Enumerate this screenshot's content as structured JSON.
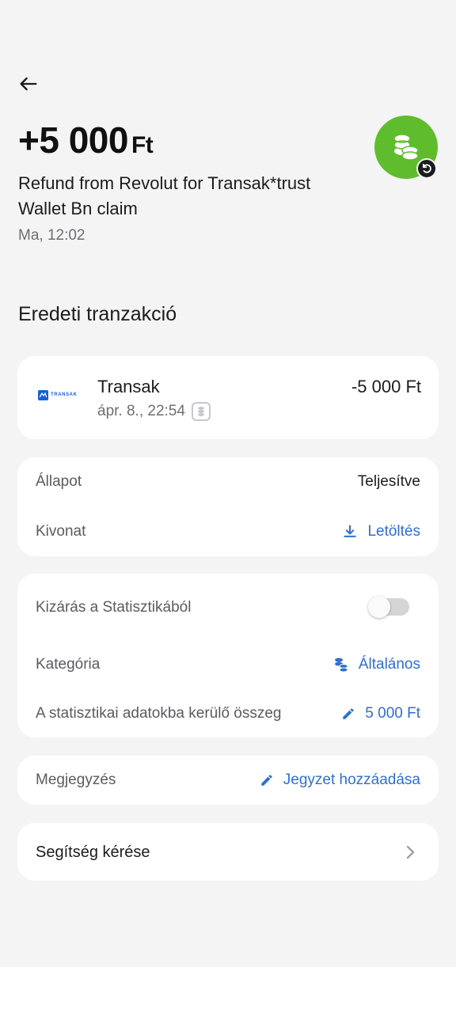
{
  "header": {
    "amount": "+5 000",
    "currency": "Ft",
    "description": "Refund from Revolut for Transak*trust Wallet Bn claim",
    "time": "Ma, 12:02",
    "avatar_color": "#5fbd2d",
    "avatar_icon": "coins-icon",
    "badge_icon": "refund-icon"
  },
  "original_section": {
    "title": "Eredeti tranzakció",
    "transaction": {
      "logo_text": "TRANSAK",
      "name": "Transak",
      "date": "ápr. 8., 22:54",
      "amount": "-5 000 Ft"
    }
  },
  "status_card": {
    "status_label": "Állapot",
    "status_value": "Teljesítve",
    "statement_label": "Kivonat",
    "statement_action": "Letöltés"
  },
  "stats_card": {
    "exclude_label": "Kizárás a Statisztikából",
    "exclude_enabled": false,
    "category_label": "Kategória",
    "category_value": "Általános",
    "stat_amount_label": "A statisztikai adatokba kerülő összeg",
    "stat_amount_value": "5 000 Ft"
  },
  "note_card": {
    "label": "Megjegyzés",
    "action": "Jegyzet hozzáadása"
  },
  "help_card": {
    "label": "Segítség kérése"
  },
  "colors": {
    "accent": "#2f6fce",
    "background": "#f4f4f4",
    "card": "#ffffff"
  }
}
